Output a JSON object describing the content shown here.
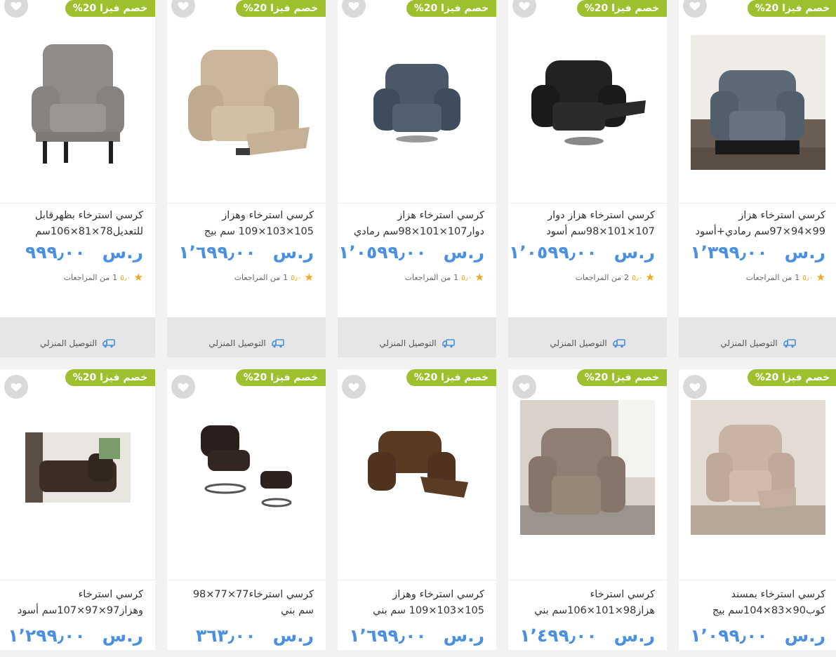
{
  "badge_text": "خصم فيزا 20%",
  "currency": "ر.س",
  "delivery_label": "التوصيل المنزلي",
  "reviews_suffix": "من المراجعات",
  "colors": {
    "badge": "#9dc02e",
    "price": "#4a90e2",
    "star": "#f5a623"
  },
  "products": [
    {
      "title": "كرسي استرخاء هزاز 99×94×97سم رمادي+أسود",
      "price": "١٬٣٩٩٫٠٠",
      "score": "٥٫٠",
      "reviews": "1"
    },
    {
      "title": "كرسي استرخاء هزاز دوار 107×101×98سم أسود",
      "price": "١٬٠٥٩٩٫٠٠",
      "score": "٥٫٠",
      "reviews": "2"
    },
    {
      "title": "كرسي استرخاء هزاز دوار107×101×98سم رمادي",
      "price": "١٬٠٥٩٩٫٠٠",
      "score": "٥٫٠",
      "reviews": "1"
    },
    {
      "title": "كرسي استرخاء وهزاز 105×103×109 سم بيج",
      "price": "١٬٦٩٩٫٠٠",
      "score": "٥٫٠",
      "reviews": "1"
    },
    {
      "title": "كرسي استرخاء بظهرقابل للتعديل78×81×106سم",
      "price": "٩٩٩٫٠٠",
      "score": "٥٫٠",
      "reviews": "1"
    },
    {
      "title": "كرسي استرخاء بمسند كوب90×83×104سم بيج",
      "price": "١٬٠٩٩٫٠٠"
    },
    {
      "title": "كرسي استرخاء هزاز98×101×106سم بني",
      "price": "١٬٤٩٩٫٠٠"
    },
    {
      "title": "كرسي استرخاء وهزاز 105×103×109 سم بني",
      "price": "١٬٦٩٩٫٠٠"
    },
    {
      "title": "كرسي استرخاء77×77×98 سم بني",
      "price": "٣٦٣٫٠٠"
    },
    {
      "title": "كرسي استرخاء وهزاز97×97×107سم أسود",
      "price": "١٬٢٩٩٫٠٠"
    }
  ]
}
